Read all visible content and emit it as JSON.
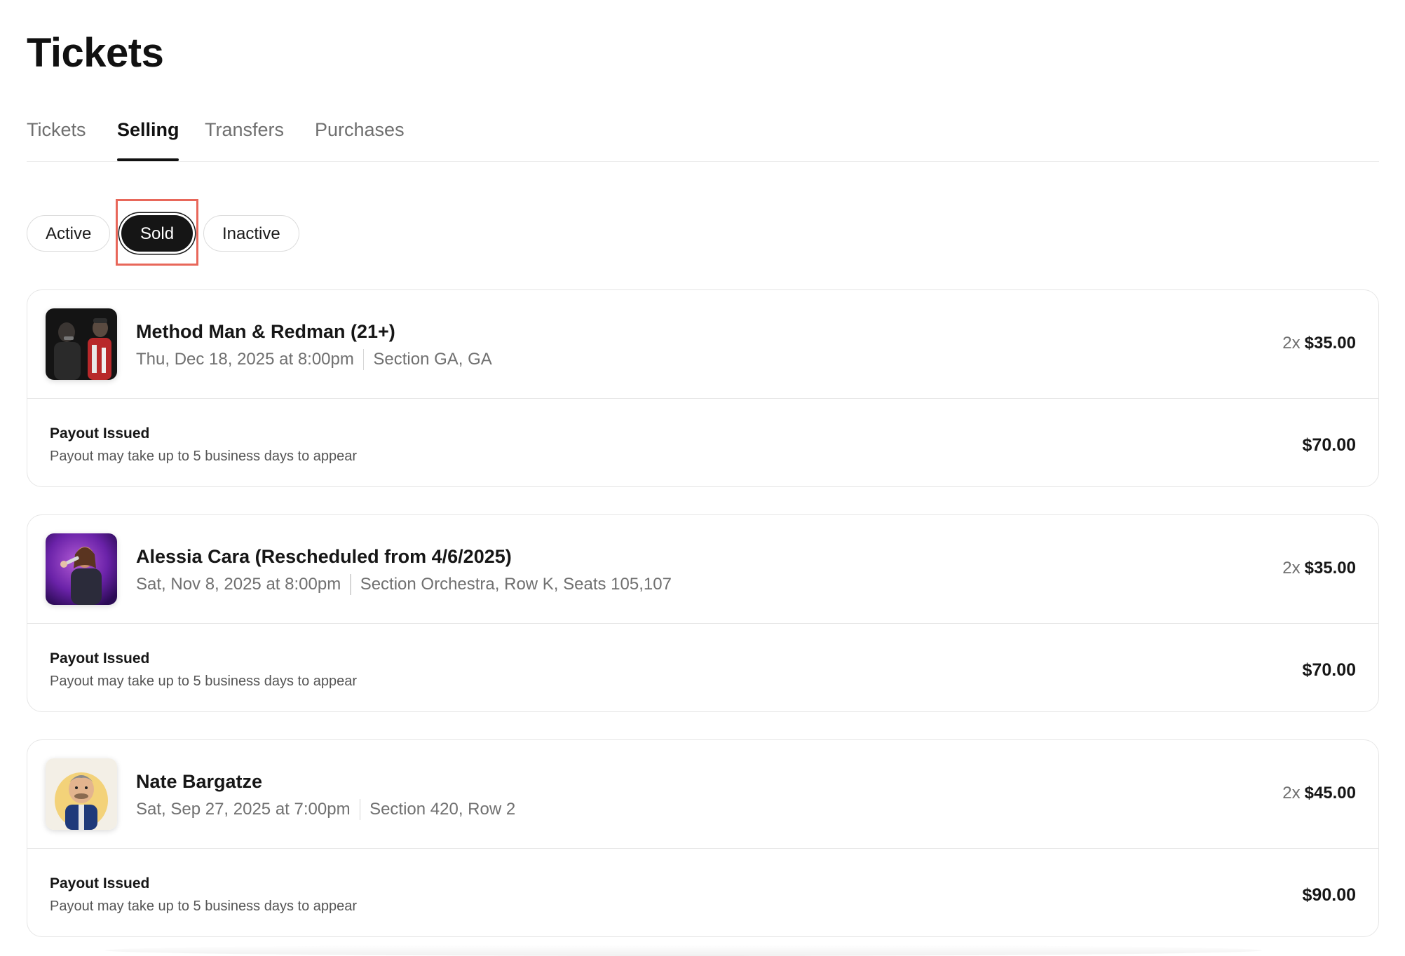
{
  "header": {
    "title": "Tickets"
  },
  "tabs": [
    {
      "label": "Tickets",
      "active": false
    },
    {
      "label": "Selling",
      "active": true
    },
    {
      "label": "Transfers",
      "active": false
    },
    {
      "label": "Purchases",
      "active": false
    }
  ],
  "filters": [
    {
      "label": "Active",
      "selected": false
    },
    {
      "label": "Sold",
      "selected": true
    },
    {
      "label": "Inactive",
      "selected": false
    }
  ],
  "listings": [
    {
      "name": "Method Man & Redman (21+)",
      "date": "Thu, Dec 18, 2025 at 8:00pm",
      "seat": "Section GA, GA",
      "quantity": "2x",
      "unit_price": "$35.00",
      "payout_status": "Payout Issued",
      "payout_note": "Payout may take up to 5 business days to appear",
      "payout_total": "$70.00",
      "thumbnail": "performers-onstage-image"
    },
    {
      "name": "Alessia Cara (Rescheduled from 4/6/2025)",
      "date": "Sat, Nov 8, 2025 at 8:00pm",
      "seat": "Section Orchestra, Row K, Seats 105,107",
      "quantity": "2x",
      "unit_price": "$35.00",
      "payout_status": "Payout Issued",
      "payout_note": "Payout may take up to 5 business days to appear",
      "payout_total": "$70.00",
      "thumbnail": "singer-purple-stage-image"
    },
    {
      "name": "Nate Bargatze",
      "date": "Sat, Sep 27, 2025 at 7:00pm",
      "seat": "Section 420, Row 2",
      "quantity": "2x",
      "unit_price": "$45.00",
      "payout_status": "Payout Issued",
      "payout_note": "Payout may take up to 5 business days to appear",
      "payout_total": "$90.00",
      "thumbnail": "comedian-caricature-image"
    }
  ],
  "colors": {
    "primary_text": "#161616",
    "secondary_text": "#707070",
    "selected_pill": "#151515",
    "highlight": "#e8675a",
    "border": "#e6e6e6"
  }
}
